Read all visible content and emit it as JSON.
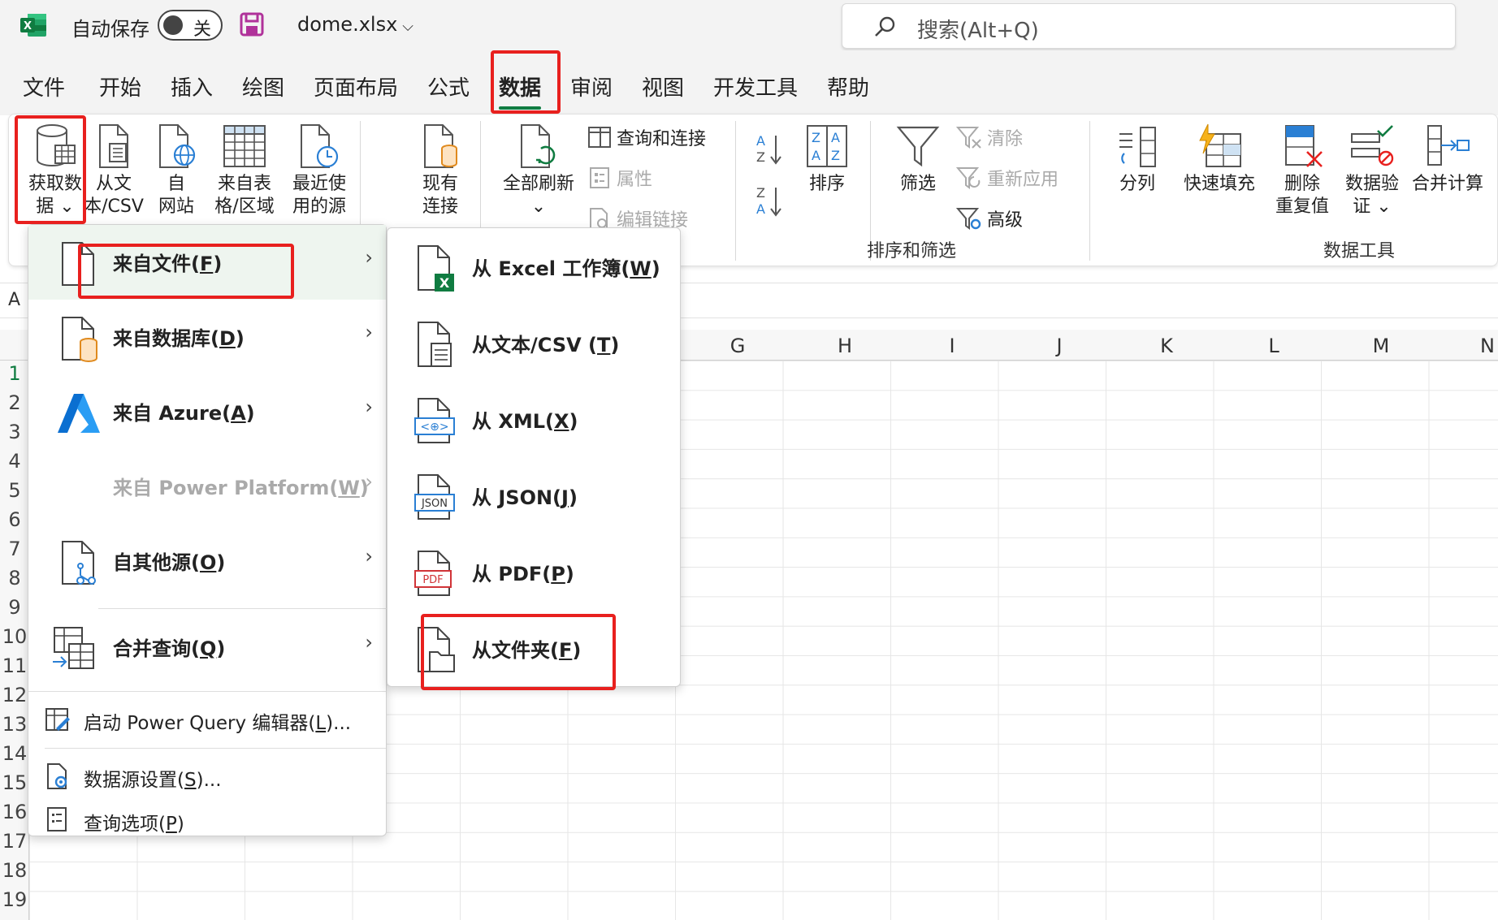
{
  "titlebar": {
    "autosave_label": "自动保存",
    "autosave_state": "关",
    "filename": "dome.xlsx",
    "search_placeholder": "搜索(Alt+Q)"
  },
  "tabs": [
    "文件",
    "开始",
    "插入",
    "绘图",
    "页面布局",
    "公式",
    "数据",
    "审阅",
    "视图",
    "开发工具",
    "帮助"
  ],
  "active_tab": "数据",
  "ribbon": {
    "get_data": [
      "获取数",
      "据 ⌄"
    ],
    "from_text": [
      "从文",
      "本/CSV"
    ],
    "from_web": [
      "自",
      "网站"
    ],
    "from_table": [
      "来自表",
      "格/区域"
    ],
    "recent": [
      "最近使",
      "用的源"
    ],
    "existing": [
      "现有",
      "连接"
    ],
    "refresh_all": [
      "全部刷新",
      "⌄"
    ],
    "queries_connections": "查询和连接",
    "properties": "属性",
    "edit_links": "编辑链接",
    "sort": "排序",
    "filter": "筛选",
    "clear": "清除",
    "reapply": "重新应用",
    "advanced": "高级",
    "group_sort_filter": "排序和筛选",
    "split": "分列",
    "flash_fill": "快速填充",
    "remove_dup": [
      "删除",
      "重复值"
    ],
    "validation": [
      "数据验",
      "证 ⌄"
    ],
    "consolidate": "合并计算",
    "group_data_tools": "数据工具"
  },
  "namebox": "A",
  "columns": [
    "G",
    "H",
    "I",
    "J",
    "K",
    "L",
    "M",
    "N"
  ],
  "rows": [
    "1",
    "2",
    "3",
    "4",
    "5",
    "6",
    "7",
    "8",
    "9",
    "10",
    "11",
    "12",
    "13",
    "14",
    "15",
    "16",
    "17",
    "18",
    "19"
  ],
  "menu1": {
    "items": [
      {
        "label": "来自文件(",
        "key": "F",
        "end": ")"
      },
      {
        "label": "来自数据库(",
        "key": "D",
        "end": ")"
      },
      {
        "label": "来自 Azure(",
        "key": "A",
        "end": ")"
      },
      {
        "label": "来自 Power Platform(",
        "key": "W",
        "end": ")"
      },
      {
        "label": "自其他源(",
        "key": "O",
        "end": ")"
      },
      {
        "label": "合并查询(",
        "key": "Q",
        "end": ")"
      }
    ],
    "small": [
      {
        "label": "启动 Power Query 编辑器(",
        "key": "L",
        "end": ")..."
      },
      {
        "label": "数据源设置(",
        "key": "S",
        "end": ")..."
      },
      {
        "label": "查询选项(",
        "key": "P",
        "end": ")"
      }
    ]
  },
  "menu2": {
    "items": [
      {
        "label": "从 Excel 工作簿(",
        "key": "W",
        "end": ")"
      },
      {
        "label": "从文本/CSV (",
        "key": "T",
        "end": ")"
      },
      {
        "label": "从 XML(",
        "key": "X",
        "end": ")"
      },
      {
        "label": "从 JSON(",
        "key": "J",
        "end": ")"
      },
      {
        "label": "从 PDF(",
        "key": "P",
        "end": ")"
      },
      {
        "label": "从文件夹(",
        "key": "F",
        "end": ")"
      }
    ]
  },
  "icons": {
    "pdf_tag": "PDF",
    "json_tag": "JSON",
    "xml_tag": "<⊕>",
    "excel_tag": "X"
  },
  "colors": {
    "excel_green": "#107c41",
    "highlight_red": "#e8201e",
    "azure_blue": "#0a6fd1"
  }
}
